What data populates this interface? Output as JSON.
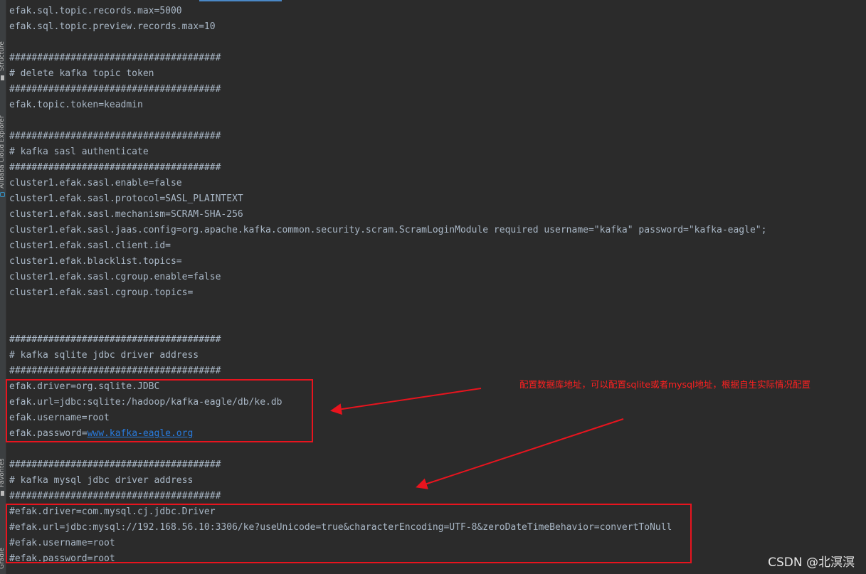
{
  "sidebar": {
    "labels": [
      "Structure",
      "Alibaba Cloud Explorer",
      "Favorites",
      "Gradle"
    ]
  },
  "editor": {
    "lines": [
      "efak.sql.topic.records.max=5000",
      "efak.sql.topic.preview.records.max=10",
      "",
      "######################################",
      "# delete kafka topic token",
      "######################################",
      "efak.topic.token=keadmin",
      "",
      "######################################",
      "# kafka sasl authenticate",
      "######################################",
      "cluster1.efak.sasl.enable=false",
      "cluster1.efak.sasl.protocol=SASL_PLAINTEXT",
      "cluster1.efak.sasl.mechanism=SCRAM-SHA-256",
      "cluster1.efak.sasl.jaas.config=org.apache.kafka.common.security.scram.ScramLoginModule required username=\"kafka\" password=\"kafka-eagle\";",
      "cluster1.efak.sasl.client.id=",
      "cluster1.efak.blacklist.topics=",
      "cluster1.efak.sasl.cgroup.enable=false",
      "cluster1.efak.sasl.cgroup.topics=",
      "",
      "",
      "######################################",
      "# kafka sqlite jdbc driver address",
      "######################################",
      "efak.driver=org.sqlite.JDBC",
      "efak.url=jdbc:sqlite:/hadoop/kafka-eagle/db/ke.db",
      "efak.username=root",
      "",
      "",
      "######################################",
      "# kafka mysql jdbc driver address",
      "######################################",
      "#efak.driver=com.mysql.cj.jdbc.Driver",
      "#efak.url=jdbc:mysql://192.168.56.10:3306/ke?useUnicode=true&characterEncoding=UTF-8&zeroDateTimeBehavior=convertToNull",
      "#efak.username=root",
      "#efak.password=root"
    ],
    "password_key": "efak.password=",
    "password_link": "www.kafka-eagle.org"
  },
  "annotation": "配置数据库地址，可以配置sqlite或者mysql地址，根据自生实际情况配置",
  "watermark": "CSDN @北溟溟",
  "colors": {
    "background": "#2b2b2b",
    "text": "#a9b7c6",
    "link": "#287bde",
    "highlight": "#e8141e"
  }
}
